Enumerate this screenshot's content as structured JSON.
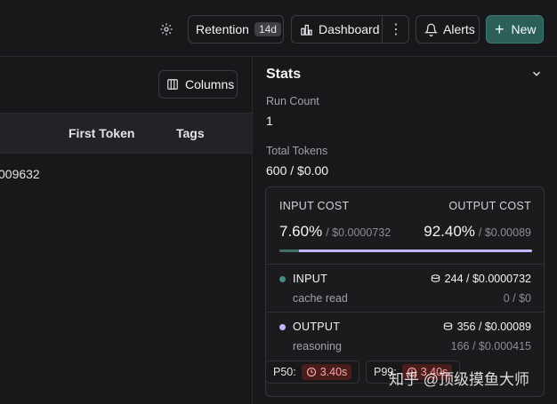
{
  "topbar": {
    "retention_label": "Retention",
    "retention_badge": "14d",
    "dashboard_label": "Dashboard",
    "alerts_label": "Alerts",
    "new_label": "New"
  },
  "table": {
    "columns_button": "Columns",
    "headers": [
      "First Token",
      "Tags"
    ],
    "partial_cell": "009632"
  },
  "stats": {
    "title": "Stats",
    "run_count_label": "Run Count",
    "run_count_value": "1",
    "total_tokens_label": "Total Tokens",
    "total_tokens_value": "600 / $0.00",
    "cost": {
      "input_header": "INPUT COST",
      "output_header": "OUTPUT COST",
      "input_pct": "7.60%",
      "input_amount": "/ $0.0000732",
      "output_pct": "92.40%",
      "output_amount": "/ $0.00089",
      "input_fraction": 0.076,
      "output_fraction": 0.924,
      "rows": [
        {
          "name": "INPUT",
          "sub": "cache read",
          "tokens": "244 / $0.0000732",
          "sub_value": "0 / $0",
          "color": "#4b8a82"
        },
        {
          "name": "OUTPUT",
          "sub": "reasoning",
          "tokens": "356 / $0.00089",
          "sub_value": "166 / $0.000415",
          "color": "#c4b5fd"
        }
      ]
    },
    "p50_label": "P50:",
    "p50_value": "3.40s",
    "p99_label": "P99:",
    "p99_value": "3.40s"
  },
  "watermark": "知乎 @顶级摸鱼大师",
  "colors": {
    "accent_new": "#2c5f58",
    "latency_pill": "#4a1d1d"
  }
}
